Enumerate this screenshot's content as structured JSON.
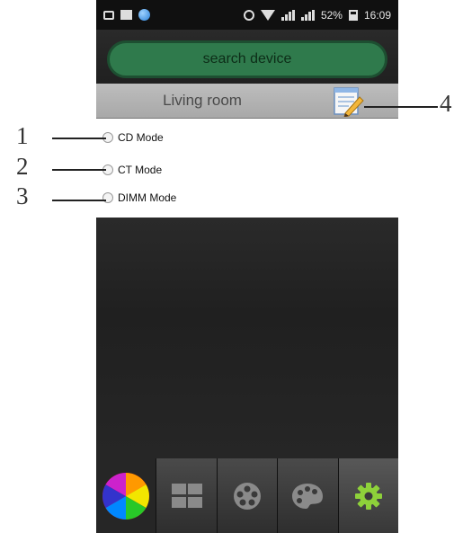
{
  "status_bar": {
    "left_icons": [
      "usb-icon",
      "image-icon",
      "globe-icon"
    ],
    "right_icons": [
      "alarm-icon",
      "wifi-icon",
      "signal-icon",
      "signal-icon",
      "battery-icon"
    ],
    "battery": "52%",
    "time": "16:09"
  },
  "header": {
    "search_button_label": "search device"
  },
  "room": {
    "title": "Living room",
    "edit_icon": "edit-notepad-icon"
  },
  "modes": [
    {
      "label": "CD Mode",
      "selected": false
    },
    {
      "label": "CT Mode",
      "selected": false
    },
    {
      "label": "DIMM Mode",
      "selected": false
    }
  ],
  "tabs": [
    {
      "icon": "color-wheel-icon"
    },
    {
      "icon": "grid-icon"
    },
    {
      "icon": "film-reel-icon"
    },
    {
      "icon": "palette-icon"
    },
    {
      "icon": "gear-icon",
      "active": true
    }
  ],
  "callouts": [
    "1",
    "2",
    "3",
    "4"
  ],
  "colors": {
    "search_button_bg": "#2f7a4c",
    "room_bar_bg": "#b3b3b3",
    "screen_bg": "#1c1c1c",
    "gear_green": "#8ed13a"
  }
}
